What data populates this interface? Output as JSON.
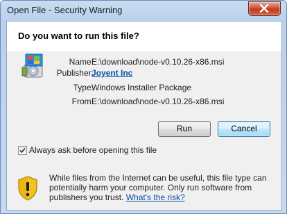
{
  "window": {
    "title": "Open File - Security Warning"
  },
  "dialog": {
    "heading": "Do you want to run this file?",
    "details": [
      {
        "label": "Name:",
        "value": "E:\\download\\node-v0.10.26-x86.msi"
      },
      {
        "label": "Publisher:",
        "value": "Joyent Inc"
      },
      {
        "label": "Type:",
        "value": "Windows Installer Package"
      },
      {
        "label": "From:",
        "value": "E:\\download\\node-v0.10.26-x86.msi"
      }
    ],
    "buttons": {
      "run": "Run",
      "cancel": "Cancel"
    },
    "checkbox": {
      "label": "Always ask before opening this file",
      "checked": true
    },
    "warning": {
      "text": "While files from the Internet can be useful, this file type can potentially harm your computer. Only run software from publishers you trust.",
      "link": "What's the risk?"
    }
  },
  "icons": {
    "file": "installer-file-icon",
    "warning": "security-shield-warning-icon",
    "close": "close-icon",
    "check": "check-icon"
  },
  "colors": {
    "link": "#0a4fa8",
    "close_button": "#c13a22",
    "shield_yellow": "#f2c31b"
  }
}
